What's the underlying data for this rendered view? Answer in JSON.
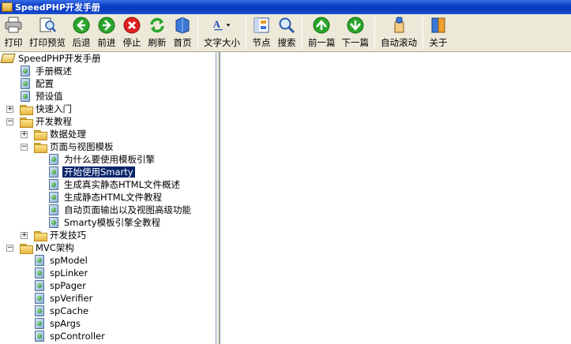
{
  "window": {
    "title": "SpeedPHP开发手册"
  },
  "toolbar": {
    "buttons": [
      {
        "label": "打印",
        "icon": "printer-icon"
      },
      {
        "label": "打印预览",
        "icon": "print-preview-icon"
      },
      {
        "label": "后退",
        "icon": "back-arrow-icon"
      },
      {
        "label": "前进",
        "icon": "forward-arrow-icon"
      },
      {
        "label": "停止",
        "icon": "stop-icon"
      },
      {
        "label": "刷新",
        "icon": "refresh-icon"
      },
      {
        "label": "首页",
        "icon": "home-icon"
      },
      {
        "label": "文字大小",
        "icon": "font-size-icon"
      },
      {
        "label": "节点",
        "icon": "node-icon"
      },
      {
        "label": "搜索",
        "icon": "search-icon"
      },
      {
        "label": "前一篇",
        "icon": "previous-article-icon"
      },
      {
        "label": "下一篇",
        "icon": "next-article-icon"
      },
      {
        "label": "自动滚动",
        "icon": "auto-scroll-icon"
      },
      {
        "label": "关于",
        "icon": "about-icon"
      }
    ]
  },
  "tree": {
    "root": "SpeedPHP开发手册",
    "items": [
      "手册概述",
      "配置",
      "预设值",
      "快速入门",
      "开发教程",
      "数据处理",
      "页面与视图模板",
      "为什么要使用模板引擎",
      "开始使用Smarty",
      "生成真实静态HTML文件概述",
      "生成静态HTML文件教程",
      "自动页面输出以及视图高级功能",
      "Smarty模板引擎全教程",
      "开发技巧",
      "MVC架构",
      "spModel",
      "spLinker",
      "spPager",
      "spVerifier",
      "spCache",
      "spArgs",
      "spController"
    ],
    "expander_plus": "+",
    "expander_minus": "−"
  },
  "colors": {
    "selection": "#0a246a",
    "titlebar": "#0a3cc0",
    "chrome": "#ece9d8"
  }
}
